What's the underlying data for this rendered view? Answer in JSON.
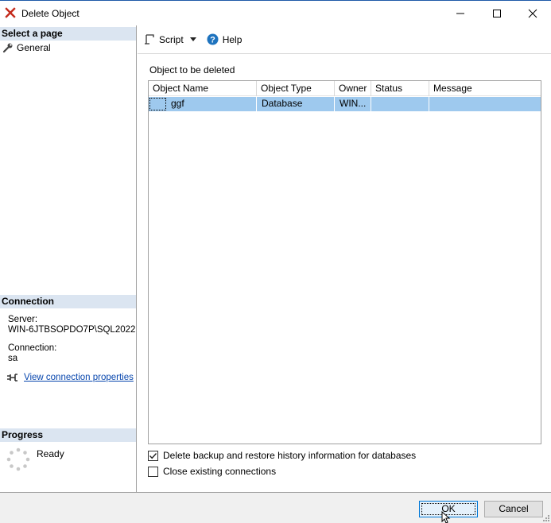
{
  "window": {
    "title": "Delete Object",
    "app_icon": "red-x-icon",
    "controls": [
      "minimize-icon",
      "maximize-icon",
      "close-icon"
    ]
  },
  "sidebar": {
    "select_page_header": "Select a page",
    "pages": [
      {
        "label": "General",
        "icon": "wrench-icon"
      }
    ],
    "connection_header": "Connection",
    "server_label": "Server:",
    "server_value": "WIN-6JTBSOPDO7P\\SQL2022",
    "connection_label": "Connection:",
    "connection_value": "sa",
    "view_connection_link": "View connection properties",
    "progress_header": "Progress",
    "progress_status": "Ready"
  },
  "toolbar": {
    "script_label": "Script",
    "help_label": "Help"
  },
  "main": {
    "objects_label": "Object to be deleted",
    "columns": [
      "Object Name",
      "Object Type",
      "Owner",
      "Status",
      "Message"
    ],
    "rows": [
      {
        "object_name": "ggf",
        "object_type": "Database",
        "owner": "WIN...",
        "status": "",
        "message": ""
      }
    ],
    "options": [
      {
        "label": "Delete backup and restore history information for databases",
        "checked": true
      },
      {
        "label": "Close existing connections",
        "checked": false
      }
    ]
  },
  "footer": {
    "ok_label": "OK",
    "cancel_label": "Cancel"
  },
  "colors": {
    "section_header_bg": "#dbe5f1",
    "selected_row_bg": "#9ec9ee",
    "link": "#0645ad",
    "close_x": "#c42b1c"
  }
}
